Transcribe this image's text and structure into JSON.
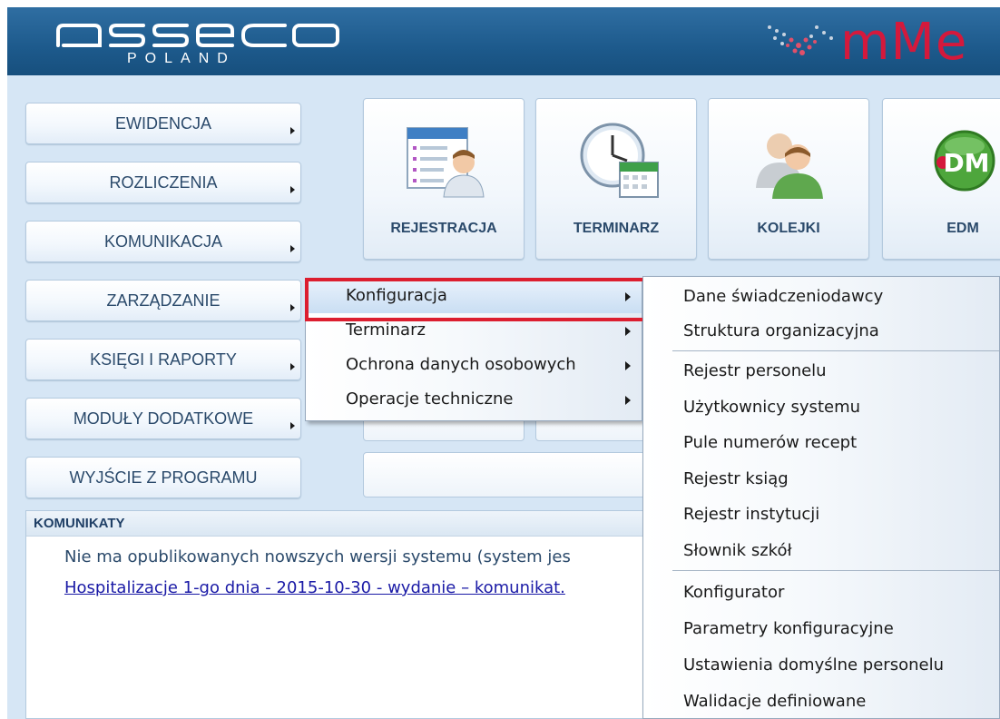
{
  "brand": {
    "logo": "asseco",
    "logo_sub": "POLAND",
    "product": "mMe"
  },
  "main_menu": [
    {
      "label": "EWIDENCJA"
    },
    {
      "label": "ROZLICZENIA"
    },
    {
      "label": "KOMUNIKACJA"
    },
    {
      "label": "ZARZĄDZANIE"
    },
    {
      "label": "KSIĘGI I RAPORTY"
    },
    {
      "label": "MODUŁY DODATKOWE"
    },
    {
      "label": "WYJŚCIE Z PROGRAMU"
    }
  ],
  "tiles": [
    {
      "label": "REJESTRACJA",
      "icon": "registration-list-icon"
    },
    {
      "label": "TERMINARZ",
      "icon": "clock-calendar-icon"
    },
    {
      "label": "KOLEJKI",
      "icon": "people-queue-icon"
    },
    {
      "label": "EDM",
      "icon": "edm-badge-icon",
      "badge_text": "DM"
    }
  ],
  "submenu_zarzadzanie": [
    {
      "label": "Konfiguracja",
      "has_submenu": true,
      "highlighted": true
    },
    {
      "label": "Terminarz",
      "has_submenu": true
    },
    {
      "label": "Ochrona danych osobowych",
      "has_submenu": true
    },
    {
      "label": "Operacje techniczne",
      "has_submenu": true
    }
  ],
  "submenu_konfiguracja": [
    {
      "label": "Dane świadczeniodawcy"
    },
    {
      "label": "Struktura organizacyjna"
    },
    {
      "label": "Rejestr personelu"
    },
    {
      "label": "Użytkownicy systemu"
    },
    {
      "label": "Pule numerów recept"
    },
    {
      "label": "Rejestr ksiąg"
    },
    {
      "label": "Rejestr instytucji"
    },
    {
      "label": "Słownik szkół"
    },
    {
      "label": "Konfigurator"
    },
    {
      "label": "Parametry konfiguracyjne"
    },
    {
      "label": "Ustawienia domyślne personelu"
    },
    {
      "label": "Walidacje definiowane"
    }
  ],
  "komunikaty": {
    "title": "KOMUNIKATY",
    "line1": "Nie ma opublikowanych nowszych wersji systemu (system jes",
    "link": "Hospitalizacje 1-go dnia - 2015-10-30 - wydanie – komunikat."
  },
  "colors": {
    "header_blue": "#1d5a8c",
    "brand_red": "#d4193c",
    "highlight_red": "#dc1e2f",
    "background": "#d6e6f5"
  }
}
